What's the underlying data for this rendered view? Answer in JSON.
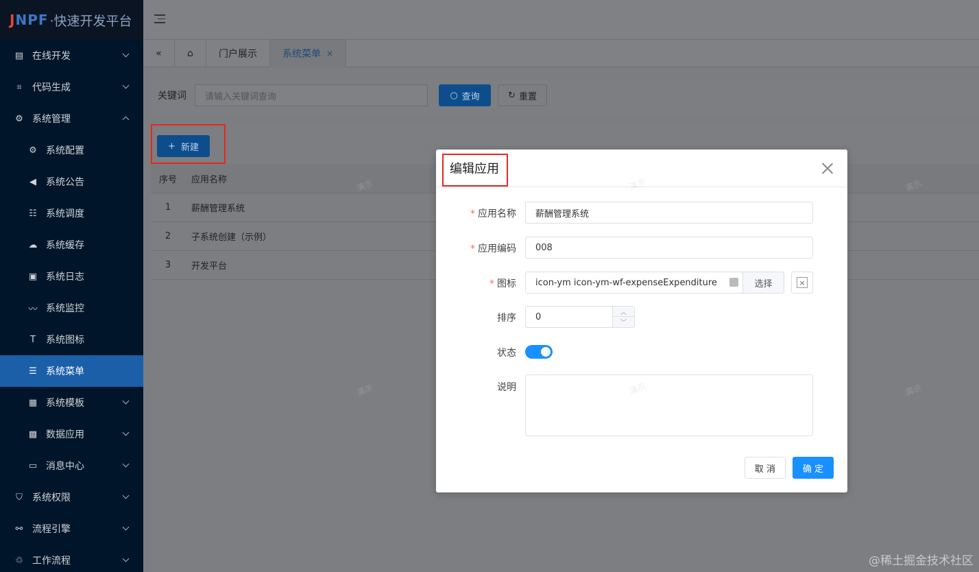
{
  "logo": {
    "brand_j": "J",
    "brand_rest": "NPF",
    "sub": "·快速开发平台"
  },
  "sidebar": {
    "items": [
      {
        "label": "在线开发",
        "icon": "terminal-icon",
        "glyph": "▤",
        "level": 1,
        "chevron": "down"
      },
      {
        "label": "代码生成",
        "icon": "code-icon",
        "glyph": "⌗",
        "level": 1,
        "chevron": "down"
      },
      {
        "label": "系统管理",
        "icon": "gear-icon",
        "glyph": "⚙",
        "level": 1,
        "chevron": "up"
      },
      {
        "label": "系统配置",
        "icon": "config-gear-icon",
        "glyph": "⚙",
        "level": 2
      },
      {
        "label": "系统公告",
        "icon": "megaphone-icon",
        "glyph": "◀",
        "level": 2
      },
      {
        "label": "系统调度",
        "icon": "schedule-icon",
        "glyph": "☷",
        "level": 2
      },
      {
        "label": "系统缓存",
        "icon": "cloud-icon",
        "glyph": "☁",
        "level": 2
      },
      {
        "label": "系统日志",
        "icon": "log-icon",
        "glyph": "▣",
        "level": 2
      },
      {
        "label": "系统监控",
        "icon": "monitor-icon",
        "glyph": "〰",
        "level": 2
      },
      {
        "label": "系统图标",
        "icon": "text-icon",
        "glyph": "T",
        "level": 2
      },
      {
        "label": "系统菜单",
        "icon": "menu-list-icon",
        "glyph": "☰",
        "level": 2,
        "active": true
      },
      {
        "label": "系统模板",
        "icon": "template-icon",
        "glyph": "▦",
        "level": 2,
        "chevron": "down"
      },
      {
        "label": "数据应用",
        "icon": "data-app-icon",
        "glyph": "▩",
        "level": 2,
        "chevron": "down"
      },
      {
        "label": "消息中心",
        "icon": "message-icon",
        "glyph": "▭",
        "level": 2,
        "chevron": "down"
      },
      {
        "label": "系统权限",
        "icon": "shield-icon",
        "glyph": "⛉",
        "level": 1,
        "chevron": "down"
      },
      {
        "label": "流程引擎",
        "icon": "flow-engine-icon",
        "glyph": "⚯",
        "level": 1,
        "chevron": "down"
      },
      {
        "label": "工作流程",
        "icon": "workflow-icon",
        "glyph": "♲",
        "level": 1,
        "chevron": "down"
      }
    ]
  },
  "tabs": {
    "collapse_icon": "«",
    "home_icon": "⌂",
    "items": [
      {
        "label": "门户展示"
      },
      {
        "label": "系统菜单",
        "active": true,
        "close": "×"
      }
    ]
  },
  "search": {
    "label": "关键词",
    "placeholder": "请输入关键词查询",
    "query_label": "查询",
    "reset_label": "重置"
  },
  "toolbar": {
    "new_label": "新建"
  },
  "table": {
    "headers": [
      "序号",
      "应用名称"
    ],
    "rows": [
      {
        "index": "1",
        "name": "薪酬管理系统"
      },
      {
        "index": "2",
        "name": "子系统创建（示例）"
      },
      {
        "index": "3",
        "name": "开发平台"
      }
    ]
  },
  "watermark": "演示",
  "dialog": {
    "title": "编辑应用",
    "fields": {
      "app_name": {
        "label": "应用名称",
        "required": true,
        "value": "薪酬管理系统"
      },
      "app_code": {
        "label": "应用编码",
        "required": true,
        "value": "008"
      },
      "icon": {
        "label": "图标",
        "required": true,
        "value": "icon-ym icon-ym-wf-expenseExpenditure",
        "select_label": "选择",
        "clear_glyph": "×"
      },
      "sort": {
        "label": "排序",
        "value": "0"
      },
      "status": {
        "label": "状态",
        "enabled": true
      },
      "description": {
        "label": "说明",
        "value": ""
      }
    },
    "cancel_label": "取 消",
    "ok_label": "确 定"
  },
  "footer_mark": "@稀土掘金技术社区",
  "colors": {
    "sidebar_bg": "#001529",
    "primary": "#1890ff",
    "highlight_box": "#e5271f"
  }
}
